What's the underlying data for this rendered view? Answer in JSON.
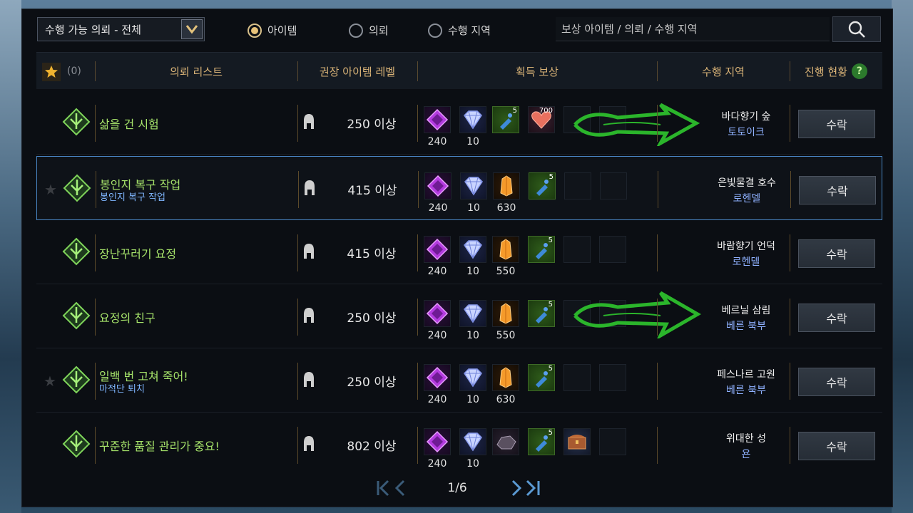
{
  "filter": {
    "dropdown_label": "수행 가능 의뢰 - 전체"
  },
  "radios": [
    {
      "label": "아이템",
      "selected": true
    },
    {
      "label": "의뢰",
      "selected": false
    },
    {
      "label": "수행 지역",
      "selected": false
    }
  ],
  "search": {
    "placeholder": "보상 아이템 / 의뢰 / 수행 지역"
  },
  "header": {
    "fav_count": "(0)",
    "quest_list": "의뢰 리스트",
    "item_level": "권장 아이템 레벨",
    "reward": "획득 보상",
    "region": "수행 지역",
    "progress": "진행 현황",
    "help": "?"
  },
  "quests": [
    {
      "title": "삶을 건 시험",
      "subtitle": "",
      "level": "250 이상",
      "rewards": [
        {
          "icon": "purple-crystal-icon",
          "value": "240"
        },
        {
          "icon": "blue-gem-icon",
          "value": "10"
        },
        {
          "icon": "potion-icon",
          "count": "5"
        },
        {
          "icon": "heart-icon",
          "count": "700"
        }
      ],
      "region_main": "바다향기 숲",
      "region_sub": "토토이크",
      "accept": "수락"
    },
    {
      "title": "봉인지 복구 작업",
      "subtitle": "봉인지 복구 작업",
      "level": "415 이상",
      "rewards": [
        {
          "icon": "purple-crystal-icon",
          "value": "240"
        },
        {
          "icon": "blue-gem-icon",
          "value": "10"
        },
        {
          "icon": "orange-crystal-icon",
          "value": "630"
        },
        {
          "icon": "potion-icon",
          "count": "5"
        }
      ],
      "region_main": "은빛물결 호수",
      "region_sub": "로헨델",
      "accept": "수락"
    },
    {
      "title": "장난꾸러기 요정",
      "subtitle": "",
      "level": "415 이상",
      "rewards": [
        {
          "icon": "purple-crystal-icon",
          "value": "240"
        },
        {
          "icon": "blue-gem-icon",
          "value": "10"
        },
        {
          "icon": "orange-crystal-icon",
          "value": "550"
        },
        {
          "icon": "potion-icon",
          "count": "5"
        }
      ],
      "region_main": "바람향기 언덕",
      "region_sub": "로헨델",
      "accept": "수락"
    },
    {
      "title": "요정의 친구",
      "subtitle": "",
      "level": "250 이상",
      "rewards": [
        {
          "icon": "purple-crystal-icon",
          "value": "240"
        },
        {
          "icon": "blue-gem-icon",
          "value": "10"
        },
        {
          "icon": "orange-crystal-icon",
          "value": "550"
        },
        {
          "icon": "potion-icon",
          "count": "5"
        }
      ],
      "region_main": "베르닐 삼림",
      "region_sub": "베른 북부",
      "accept": "수락"
    },
    {
      "title": "일백 번 고쳐 죽어!",
      "subtitle": "마적단 퇴치",
      "level": "250 이상",
      "rewards": [
        {
          "icon": "purple-crystal-icon",
          "value": "240"
        },
        {
          "icon": "blue-gem-icon",
          "value": "10"
        },
        {
          "icon": "orange-crystal-icon",
          "value": "630"
        },
        {
          "icon": "potion-icon",
          "count": "5"
        }
      ],
      "region_main": "페스나르 고원",
      "region_sub": "베른 북부",
      "accept": "수락"
    },
    {
      "title": "꾸준한 품질 관리가 중요!",
      "subtitle": "",
      "level": "802 이상",
      "rewards": [
        {
          "icon": "purple-crystal-icon",
          "value": "240"
        },
        {
          "icon": "blue-gem-icon",
          "value": "10"
        },
        {
          "icon": "dark-ore-icon",
          "value": ""
        },
        {
          "icon": "potion-icon",
          "count": "5"
        },
        {
          "icon": "chest-icon",
          "value": ""
        }
      ],
      "region_main": "위대한 성",
      "region_sub": "욘",
      "accept": "수락"
    }
  ],
  "pagination": {
    "current": "1/6"
  },
  "colors": {
    "accent_gold": "#d9b377",
    "quest_green": "#a6e36a",
    "sub_blue": "#7fb6ff"
  }
}
